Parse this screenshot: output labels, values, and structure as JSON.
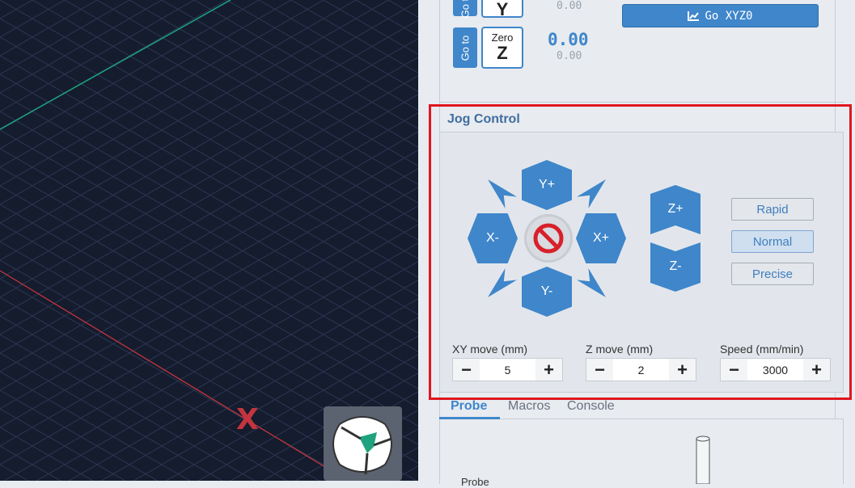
{
  "dro": {
    "goto_label": "Go to",
    "zero_label": "Zero",
    "axis_y": "Y",
    "axis_z": "Z",
    "y_machine": "0.00",
    "z_work": "0.00",
    "z_machine": "0.00",
    "goto_xyz0_label": "Go XYZ0"
  },
  "jog": {
    "title": "Jog Control",
    "y_plus": "Y+",
    "y_minus": "Y-",
    "x_plus": "X+",
    "x_minus": "X-",
    "z_plus": "Z+",
    "z_minus": "Z-",
    "modes": [
      "Rapid",
      "Normal",
      "Precise"
    ],
    "active_mode": "Normal",
    "xy_move_label": "XY move (mm)",
    "xy_move_value": "5",
    "z_move_label": "Z move (mm)",
    "z_move_value": "2",
    "speed_label": "Speed (mm/min)",
    "speed_value": "3000",
    "minus": "−",
    "plus": "+"
  },
  "tabs": [
    "Probe",
    "Macros",
    "Console"
  ],
  "active_tab": "Probe",
  "probe_label": "Probe",
  "viewport": {
    "x_axis_label": "X"
  },
  "colors": {
    "accent": "#3f86ca",
    "highlight": "#e0161f",
    "viewport_bg": "#141c2e",
    "x_axis": "#c4343e",
    "y_axis": "#1fa37f"
  }
}
